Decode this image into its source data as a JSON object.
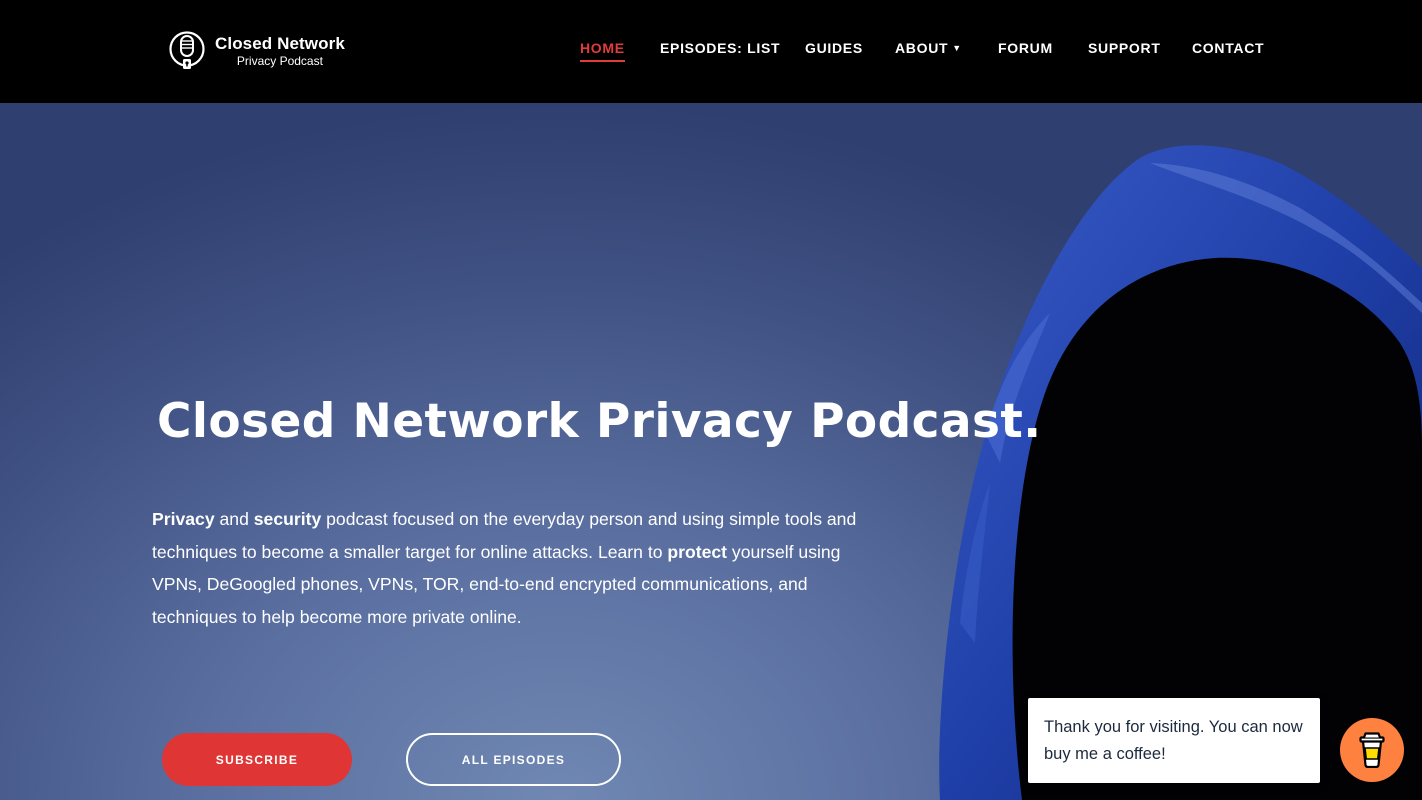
{
  "brand": {
    "title": "Closed Network",
    "subtitle": "Privacy Podcast",
    "icon": "microphone-icon"
  },
  "nav": {
    "items": [
      {
        "label": "HOME",
        "active": true
      },
      {
        "label": "EPISODES: LIST",
        "active": false
      },
      {
        "label": "GUIDES",
        "active": false
      },
      {
        "label": "ABOUT",
        "active": false,
        "has_dropdown": true
      },
      {
        "label": "FORUM",
        "active": false
      },
      {
        "label": "SUPPORT",
        "active": false
      },
      {
        "label": "CONTACT",
        "active": false
      }
    ],
    "dropdown_icon": "chevron-down-icon"
  },
  "hero": {
    "title": "Closed Network Privacy Podcast.",
    "description": {
      "w1": "Privacy",
      "t1": " and ",
      "w2": "security",
      "t2": " podcast focused on the everyday person and using simple tools and techniques to become a smaller target for online attacks. Learn to ",
      "w3": "protect",
      "t3": " yourself using VPNs, DeGoogled phones, VPNs, TOR, end-to-end encrypted communications, and techniques to help become more private online."
    },
    "buttons": {
      "subscribe": "SUBSCRIBE",
      "all_episodes": "ALL EPISODES"
    }
  },
  "coffee": {
    "message": "Thank you for visiting. You can now buy me a coffee!",
    "icon": "coffee-cup-icon"
  },
  "colors": {
    "accent": "#e03d3a",
    "subscribe": "#e03535",
    "coffee": "#ff813f",
    "header_bg": "#000000"
  }
}
